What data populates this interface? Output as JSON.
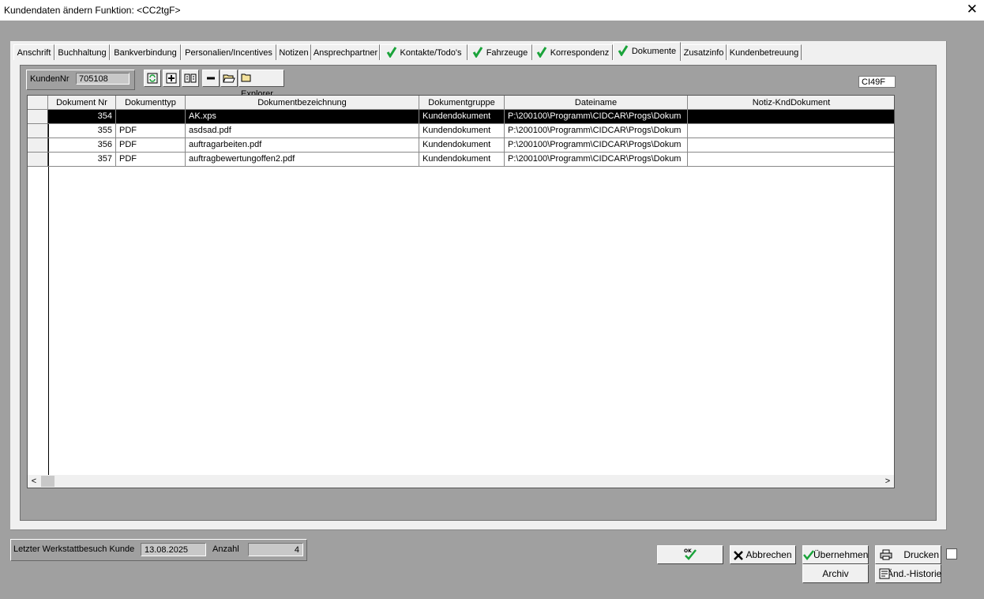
{
  "window": {
    "title": "Kundendaten ändern  Funktion: <CC2tgF>",
    "close_label": "✕"
  },
  "tabs": [
    {
      "label": "Anschrift",
      "check": false,
      "active": false
    },
    {
      "label": "Buchhaltung",
      "check": false,
      "active": false
    },
    {
      "label": "Bankverbindung",
      "check": false,
      "active": false
    },
    {
      "label": "Personalien/Incentives",
      "check": false,
      "active": false
    },
    {
      "label": "Notizen",
      "check": false,
      "active": false
    },
    {
      "label": "Ansprechpartner",
      "check": false,
      "active": false
    },
    {
      "label": "Kontakte/Todo's",
      "check": true,
      "active": false
    },
    {
      "label": "Fahrzeuge",
      "check": true,
      "active": false
    },
    {
      "label": "Korrespondenz",
      "check": true,
      "active": false
    },
    {
      "label": "Dokumente",
      "check": true,
      "active": true
    },
    {
      "label": "Zusatzinfo",
      "check": false,
      "active": false
    },
    {
      "label": "Kundenbetreuung",
      "check": false,
      "active": false
    }
  ],
  "toolbar": {
    "kunden_label": "KundenNr",
    "kunden_value": "705108",
    "icons": [
      "refresh-icon",
      "add-icon",
      "move-icon",
      "remove-icon",
      "open-folder-icon"
    ],
    "explorer_label": "Explorer",
    "code": "CI49F"
  },
  "grid": {
    "columns": [
      "Dokument Nr",
      "Dokumenttyp",
      "Dokumentbezeichnung",
      "Dokumentgruppe",
      "Dateiname",
      "Notiz-KndDokument"
    ],
    "rows": [
      {
        "nr": "354",
        "typ": "",
        "bez": "AK.xps",
        "gruppe": "Kundendokument",
        "datei": "P:\\200100\\Programm\\CIDCAR\\Progs\\Dokum",
        "notiz": "",
        "selected": true
      },
      {
        "nr": "355",
        "typ": "PDF",
        "bez": "asdsad.pdf",
        "gruppe": "Kundendokument",
        "datei": "P:\\200100\\Programm\\CIDCAR\\Progs\\Dokum",
        "notiz": "",
        "selected": false
      },
      {
        "nr": "356",
        "typ": "PDF",
        "bez": "auftragarbeiten.pdf",
        "gruppe": "Kundendokument",
        "datei": "P:\\200100\\Programm\\CIDCAR\\Progs\\Dokum",
        "notiz": "",
        "selected": false
      },
      {
        "nr": "357",
        "typ": "PDF",
        "bez": "auftragbewertungoffen2.pdf",
        "gruppe": "Kundendokument",
        "datei": "P:\\200100\\Programm\\CIDCAR\\Progs\\Dokum",
        "notiz": "",
        "selected": false
      }
    ]
  },
  "footer": {
    "werkstatt_label": "Letzter Werkstattbesuch Kunde",
    "werkstatt_value": "13.08.2025",
    "anzahl_label": "Anzahl",
    "anzahl_value": "4"
  },
  "buttons": {
    "ok": "OK",
    "abbrechen": "Abbrechen",
    "uebernehmen": "Übernehmen",
    "drucken": "Drucken",
    "archiv": "Archiv",
    "historie": "Änd.-Historie"
  },
  "colors": {
    "check_green": "#1aa33a",
    "selection": "#000000"
  }
}
